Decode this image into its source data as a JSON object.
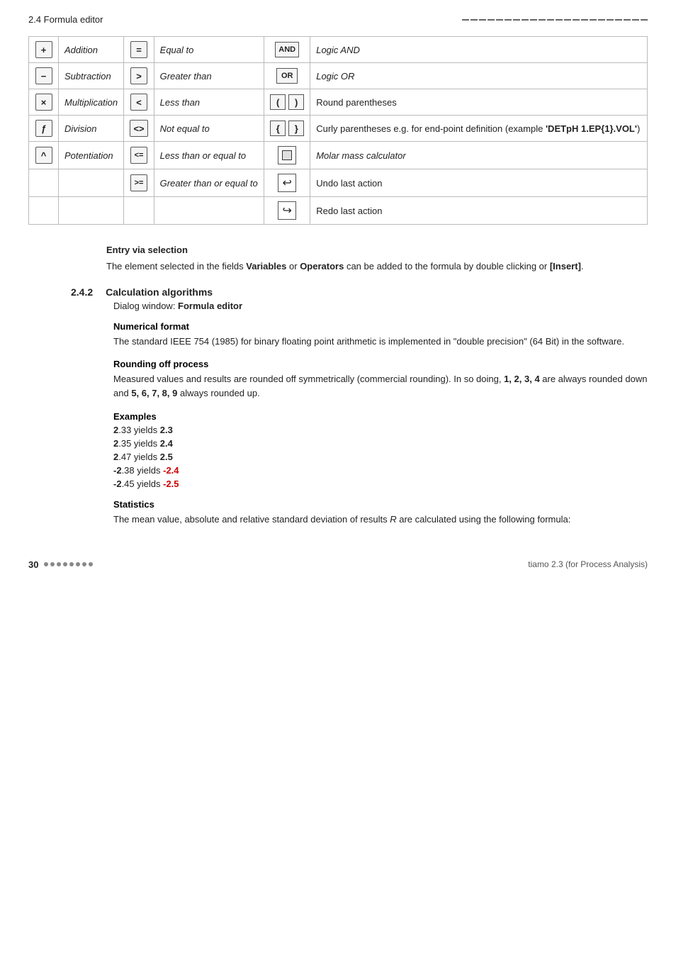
{
  "header": {
    "left": "2.4 Formula editor",
    "right_dashes": 22
  },
  "table": {
    "rows": [
      {
        "icon1": "+",
        "label1": "Addition",
        "icon2": "=",
        "label2": "Equal to",
        "icon3_type": "text",
        "icon3": "AND",
        "label3": "Logic AND"
      },
      {
        "icon1": "−",
        "label1": "Subtraction",
        "icon2": ">",
        "label2": "Greater than",
        "icon3_type": "text",
        "icon3": "OR",
        "label3": "Logic OR"
      },
      {
        "icon1": "×",
        "label1": "Multiplication",
        "icon2": "<",
        "label2": "Less than",
        "icon3_type": "parens",
        "icon3_left": "(",
        "icon3_right": ")",
        "label3": "Round parentheses"
      },
      {
        "icon1": "ƒ",
        "label1": "Division",
        "icon2": "<>",
        "label2": "Not equal to",
        "icon3_type": "curly",
        "icon3_left": "{",
        "icon3_right": "}",
        "label3": "Curly parentheses e.g. for end-point definition (example 'DETpH 1.EP{1}.VOL')"
      },
      {
        "icon1": "^",
        "label1": "Potentiation",
        "icon2": "<=",
        "label2": "Less than or equal to",
        "icon3_type": "molar",
        "label3": "Molar mass calculator"
      },
      {
        "icon1": "",
        "label1": "",
        "icon2": ">=",
        "label2": "Greater than or equal to",
        "icon3_type": "undo",
        "label3": "Undo last action"
      },
      {
        "icon1": "",
        "label1": "",
        "icon2": "",
        "label2": "",
        "icon3_type": "redo",
        "label3": "Redo last action"
      }
    ]
  },
  "entry_selection": {
    "heading": "Entry via selection",
    "body": "The element selected in the fields ",
    "bold1": "Variables",
    "mid": " or ",
    "bold2": "Operators",
    "end": " can be added to the formula by double clicking or ",
    "bold3": "[Insert]",
    "period": "."
  },
  "section_242": {
    "number": "2.4.2",
    "title": "Calculation algorithms",
    "dialog_label": "Dialog window: ",
    "dialog_bold": "Formula editor",
    "subsections": [
      {
        "heading": "Numerical format",
        "body": "The standard IEEE 754 (1985) for binary floating point arithmetic is implemented in \"double precision\" (64 Bit) in the software."
      },
      {
        "heading": "Rounding off process",
        "body1": "Measured values and results are rounded off symmetrically (commercial rounding). In so doing, ",
        "bold_nums": "1, 2, 3, 4",
        "body2": " are always rounded down and ",
        "bold_nums2": "5, 6, 7, 8, 9",
        "body3": " always rounded up."
      },
      {
        "heading": "Examples",
        "examples": [
          {
            "input": "2.33",
            "yields": "yields",
            "output": "2.3",
            "negative": false
          },
          {
            "input": "2.35",
            "yields": "yields",
            "output": "2.4",
            "negative": false
          },
          {
            "input": "2.47",
            "yields": "yields",
            "output": "2.5",
            "negative": false
          },
          {
            "input": "-2.38",
            "yields": "yields",
            "output": "-2.4",
            "negative": true
          },
          {
            "input": "-2.45",
            "yields": "yields",
            "output": "-2.5",
            "negative": true
          }
        ]
      },
      {
        "heading": "Statistics",
        "body": "The mean value, absolute and relative standard deviation of results R are calculated using the following formula:"
      }
    ]
  },
  "footer": {
    "page_number": "30",
    "dots_count": 8,
    "product": "tiamo 2.3 (for Process Analysis)"
  }
}
